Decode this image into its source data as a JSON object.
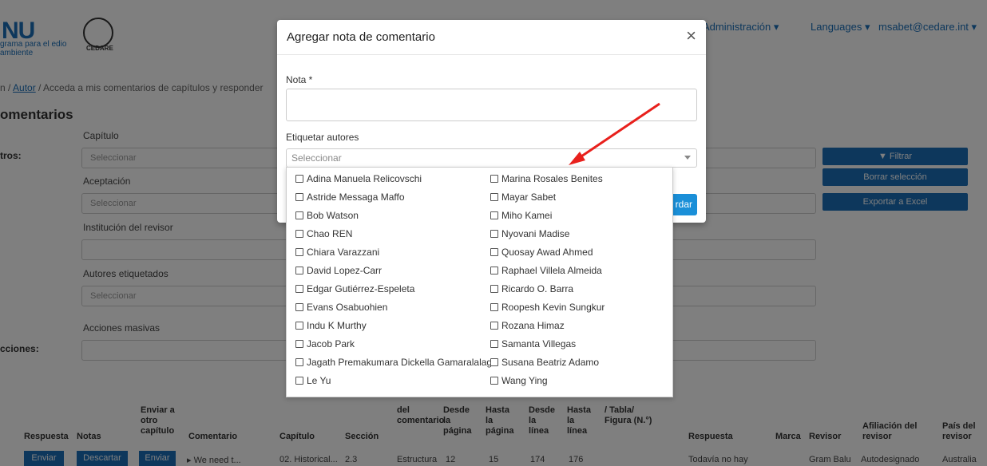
{
  "background": {
    "logo_text": "NU",
    "logo_sub": "grama para el edio ambiente",
    "logo_cedare": "CEDARE",
    "nav_admin": "Administración ▾",
    "nav_languages": "Languages ▾",
    "nav_user": "msabet@cedare.int ▾",
    "breadcrumb_prefix": "n /",
    "breadcrumb_link": "Autor",
    "breadcrumb_rest": "/ Acceda a mis comentarios de capítulos y responder",
    "page_title": "omentarios",
    "filters_label": "tros:",
    "actions_label": "cciones:",
    "field_capitulo": "Capítulo",
    "field_aceptacion": "Aceptación",
    "field_institucion": "Institución del revisor",
    "field_autores": "Autores etiquetados",
    "field_acciones": "Acciones masivas",
    "placeholder": "Seleccionar",
    "btn_filtrar": "▼ Filtrar",
    "btn_borrar": "Borrar selección",
    "btn_exportar": "Exportar a Excel",
    "table_headers": [
      "Respuesta",
      "Notas",
      "Enviar a otro capítulo",
      "Comentario",
      "Capítulo",
      "Sección",
      "del comentario",
      "Desde la página",
      "Hasta la página",
      "Desde la línea",
      "Hasta la línea",
      "/ Tabla/ Figura (N.°)",
      "Respuesta",
      "Marca",
      "Revisor",
      "Afiliación del revisor",
      "País del revisor"
    ],
    "row": {
      "btn_enviar": "Enviar",
      "btn_descartar": "Descartar",
      "btn_enviar2": "Enviar",
      "comentario": "▸ We need t...",
      "capitulo": "02. Historical...",
      "seccion": "2.3",
      "tipo": "Estructura",
      "desde_pag": "12",
      "hasta_pag": "15",
      "desde_lin": "174",
      "hasta_lin": "176",
      "respuesta": "Todavía no hay",
      "revisor": "Gram Balu",
      "afiliacion": "Autodesignado",
      "pais": "Australia"
    }
  },
  "modal": {
    "title": "Agregar nota de comentario",
    "close": "×",
    "nota_label": "Nota *",
    "nota_value": "",
    "tag_label": "Etiquetar autores",
    "tag_placeholder": "Seleccionar",
    "save_label": "Guardar",
    "save_visible": "rdar"
  },
  "authors_left": [
    "Adina Manuela Relicovschi",
    "Astride Messaga Maffo",
    "Bob Watson",
    "Chao REN",
    "Chiara Varazzani",
    "David Lopez-Carr",
    "Edgar Gutiérrez-Espeleta",
    "Evans Osabuohien",
    "Indu K Murthy",
    "Jacob Park",
    "Jagath Premakumara Dickella Gamaralalage",
    "Le Yu"
  ],
  "authors_right": [
    "Marina Rosales Benites",
    "Mayar Sabet",
    "Miho Kamei",
    "Nyovani Madise",
    "Quosay Awad Ahmed",
    "Raphael Villela Almeida",
    "Ricardo O. Barra",
    "Roopesh Kevin Sungkur",
    "Rozana Himaz",
    "Samanta Villegas",
    "Susana Beatriz Adamo",
    "Wang Ying"
  ],
  "colors": {
    "primary": "#1a6fb8",
    "save": "#1a8fd8",
    "arrow": "#e8201c",
    "overlay": "rgba(0,0,0,0.5)"
  }
}
